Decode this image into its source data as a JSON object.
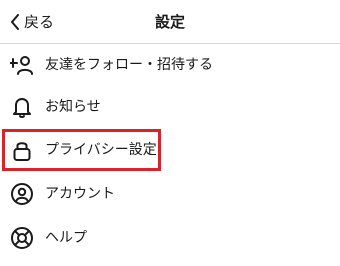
{
  "header": {
    "back_label": "戻る",
    "title": "設定"
  },
  "menu": [
    {
      "label": "友達をフォロー・招待する",
      "icon": "add-user-icon"
    },
    {
      "label": "お知らせ",
      "icon": "bell-icon"
    },
    {
      "label": "プライバシー設定",
      "icon": "lock-icon",
      "highlighted": true
    },
    {
      "label": "アカウント",
      "icon": "account-icon"
    },
    {
      "label": "ヘルプ",
      "icon": "lifebuoy-icon"
    }
  ],
  "colors": {
    "highlight": "#d8232a",
    "text": "#1a1a1a",
    "divider": "#d8d8d8"
  }
}
